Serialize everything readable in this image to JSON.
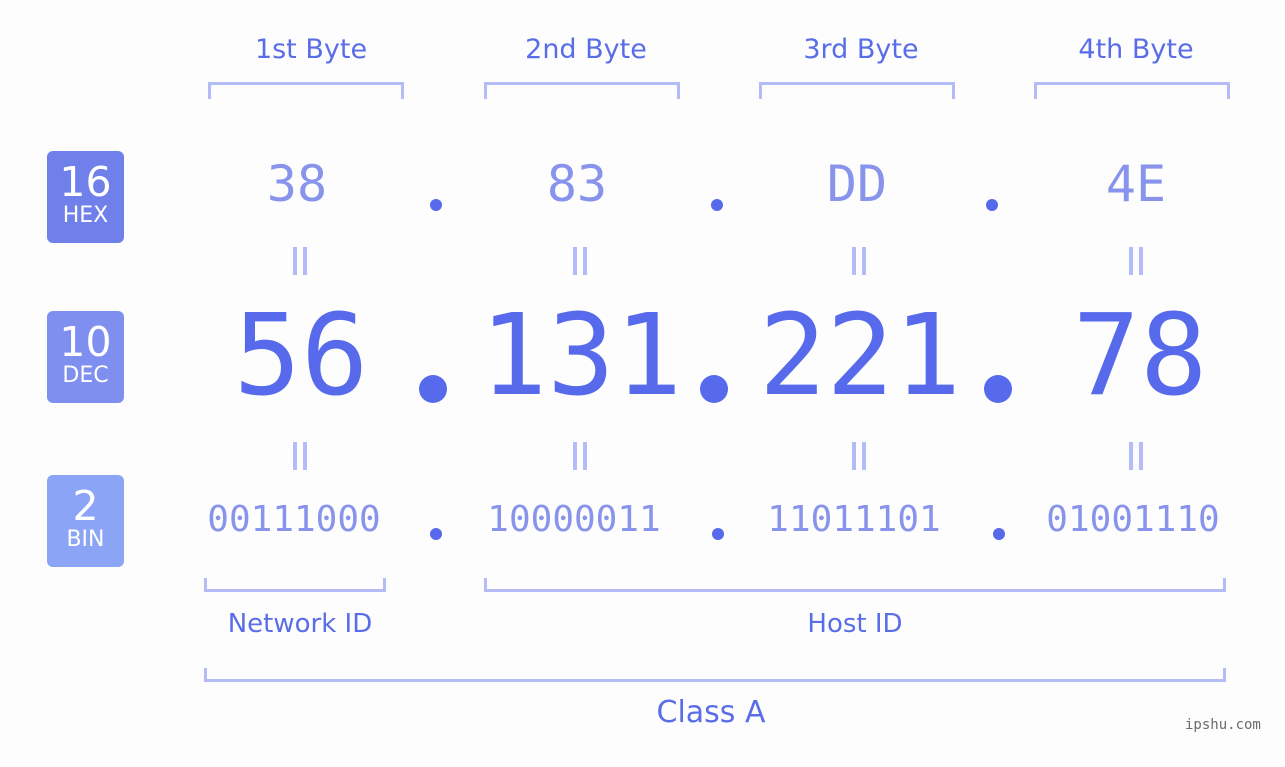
{
  "bytes": [
    {
      "label": "1st Byte",
      "hex": "38",
      "dec": "56",
      "bin": "00111000"
    },
    {
      "label": "2nd Byte",
      "hex": "83",
      "dec": "131",
      "bin": "10000011"
    },
    {
      "label": "3rd Byte",
      "hex": "DD",
      "dec": "221",
      "bin": "11011101"
    },
    {
      "label": "4th Byte",
      "hex": "4E",
      "dec": "78",
      "bin": "01001110"
    }
  ],
  "badges": {
    "hex": {
      "num": "16",
      "label": "HEX",
      "color": "#6f80ea"
    },
    "dec": {
      "num": "10",
      "label": "DEC",
      "color": "#7f8ff0"
    },
    "bin": {
      "num": "2",
      "label": "BIN",
      "color": "#8ca4f6"
    }
  },
  "segments": {
    "network": "Network ID",
    "host": "Host ID",
    "class": "Class A"
  },
  "watermark": "ipshu.com",
  "colors": {
    "accent": "#566aeb",
    "light": "#8893ec",
    "bracket": "#b3bcf7"
  }
}
